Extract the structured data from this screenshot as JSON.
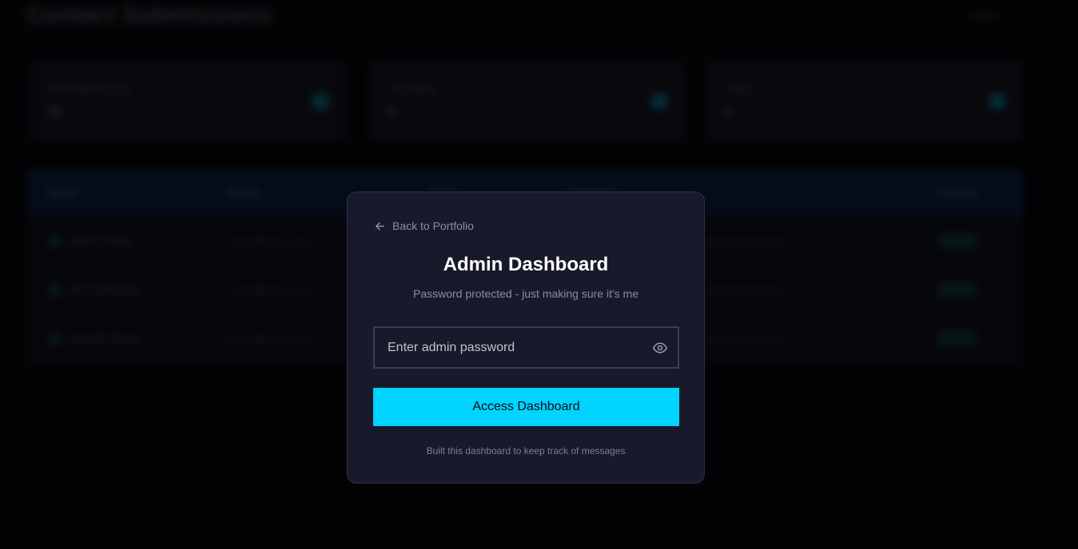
{
  "background": {
    "title": "Contact Submissions",
    "logout_label": "Logout",
    "stats": [
      {
        "label": "Total Submissions",
        "value": "83"
      },
      {
        "label": "This Week",
        "value": "4"
      },
      {
        "label": "Today",
        "value": "0"
      }
    ],
    "table": {
      "headers": [
        "Name",
        "Email",
        "Date",
        "Message",
        "Actions"
      ],
      "rows": [
        {
          "name": "Admin Rowell",
          "email": "r••••••@••••••.com",
          "message": "••••••••••••••••••••••••"
        },
        {
          "name": "Nick Dobrianski",
          "email": "n••••••@••••••.com",
          "message": "••••••••••••••••••••••••"
        },
        {
          "name": "Ashwath Bharat",
          "email": "a••••••@••••••.com",
          "message": "••••••••••••••••••••••••"
        }
      ]
    }
  },
  "modal": {
    "back_label": "Back to Portfolio",
    "title": "Admin Dashboard",
    "subtitle": "Password protected - just making sure it's me",
    "password_placeholder": "Enter admin password",
    "password_value": "",
    "submit_label": "Access Dashboard",
    "footnote": "Built this dashboard to keep track of messages"
  },
  "icons": {
    "back": "arrow-left-icon",
    "toggle_visibility": "eye-icon",
    "stat": "circle-icon"
  },
  "colors": {
    "accent": "#00d4ff",
    "modal_bg": "#181a2b",
    "page_bg": "#030305"
  }
}
